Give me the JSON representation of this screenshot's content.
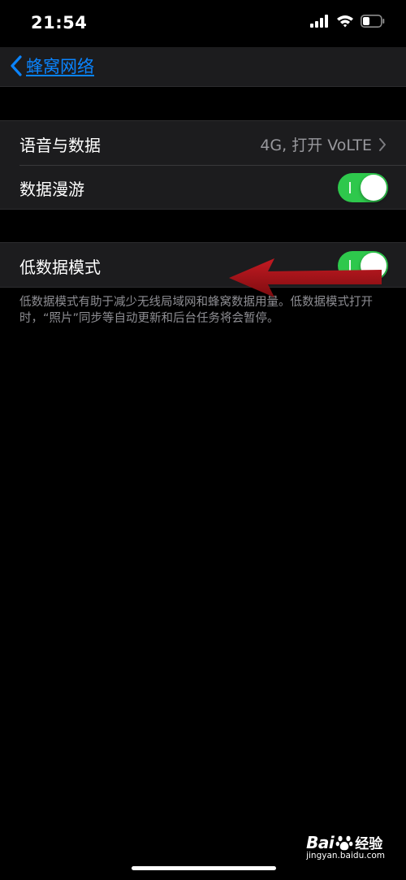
{
  "status_bar": {
    "time": "21:54",
    "icons": [
      "cellular-signal-icon",
      "wifi-icon",
      "battery-icon"
    ]
  },
  "nav": {
    "back_label": "蜂窝网络",
    "back_icon": "chevron-left-icon"
  },
  "section1": {
    "rows": [
      {
        "label": "语音与数据",
        "value": "4G, 打开 VoLTE",
        "accessory": "chevron-right-icon"
      },
      {
        "label": "数据漫游",
        "toggle_on": true
      }
    ]
  },
  "section2": {
    "rows": [
      {
        "label": "低数据模式",
        "toggle_on": true
      }
    ],
    "footer": "低数据模式有助于减少无线局域网和蜂窝数据用量。低数据模式打开时，“照片”同步等自动更新和后台任务将会暂停。"
  },
  "annotation": {
    "type": "red-arrow",
    "color": "#a3141a"
  },
  "watermark": {
    "brand": "Bai",
    "brand_cn": "经验",
    "site": "jingyan.baidu.com"
  },
  "colors": {
    "background": "#000000",
    "cell": "#1c1c1e",
    "accent": "#0a84ff",
    "toggle_on": "#2ec84c",
    "secondary_text": "#98989d"
  }
}
